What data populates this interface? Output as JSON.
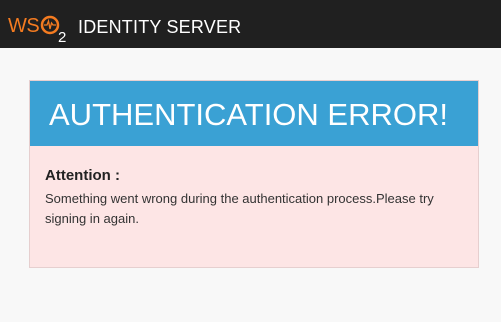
{
  "header": {
    "logo_text": "WSO2",
    "product_name": "IDENTITY SERVER"
  },
  "error": {
    "title": "AUTHENTICATION ERROR!",
    "attention_label": "Attention :",
    "message": "Something went wrong during the authentication process.Please try signing in again."
  },
  "colors": {
    "topbar": "#202020",
    "logo_orange": "#f47b20",
    "header_blue": "#3aa1d4",
    "error_bg": "#fde5e5"
  }
}
